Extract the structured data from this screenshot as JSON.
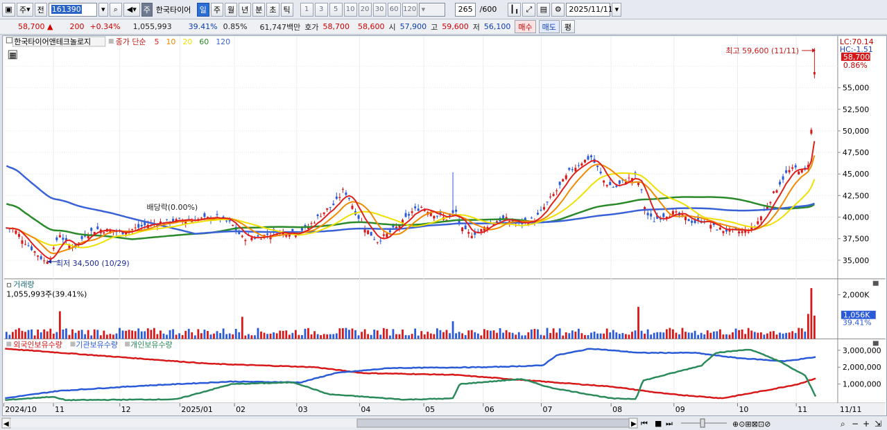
{
  "toolbar": {
    "market": "주",
    "prev_btn": "전",
    "stock_code": "161390",
    "stock_name": "한국타이어",
    "periods": [
      "일",
      "주",
      "월",
      "년",
      "분",
      "초",
      "틱"
    ],
    "active_period": "일",
    "intervals": [
      "1",
      "3",
      "5",
      "10",
      "20",
      "30",
      "60",
      "120"
    ],
    "count_value": "265",
    "count_total": "/600",
    "date": "2025/11/11"
  },
  "quote": {
    "price": "58,700",
    "change": "200",
    "change_pct": "+0.34%",
    "volume": "1,055,993",
    "vol_ratio": "39.41%",
    "rate": "0.85%",
    "amount": "61,747백만",
    "ask_label": "호가",
    "ask1": "58,700",
    "ask2": "58,600",
    "open_label": "시",
    "open": "57,900",
    "high_label": "고",
    "high": "59,600",
    "low_label": "저",
    "low": "56,100",
    "buy_btn": "매수",
    "sell_btn": "매도",
    "avg_btn": "평"
  },
  "legend": {
    "stock": "한국타이어앤테크놀로지",
    "ma_title": "종가 단순",
    "ma": [
      {
        "p": "5",
        "color": "#e0201c"
      },
      {
        "p": "10",
        "color": "#f08a00"
      },
      {
        "p": "20",
        "color": "#f0e000"
      },
      {
        "p": "60",
        "color": "#2a8a2a"
      },
      {
        "p": "120",
        "color": "#3a62d8"
      }
    ]
  },
  "annotations": {
    "high": "최고 59,600 (11/11)",
    "low": "최저 34,500 (10/29)",
    "dividend": "배당락(0.00%)"
  },
  "price_axis": {
    "lc": "LC:70.14",
    "hc": "HC:-1.51",
    "current": "58,700",
    "current_pct": "0.86%",
    "ticks": [
      "55,000",
      "52,500",
      "50,000",
      "47,500",
      "45,000",
      "42,500",
      "40,000",
      "37,500",
      "35,000"
    ]
  },
  "volume_panel": {
    "title": "거래량",
    "value": "1,055,993주(39.41%)",
    "axis_top": "2,000K",
    "current": "1,056K",
    "current_pct": "39.41%"
  },
  "holdings_panel": {
    "series": [
      {
        "name": "외국인보유수량",
        "color": "#d81818"
      },
      {
        "name": "기관보유수량",
        "color": "#2a5ad8"
      },
      {
        "name": "개인보유수량",
        "color": "#2a8a5a"
      }
    ],
    "ticks": [
      "3,000,000",
      "2,000,000",
      "1,000,000"
    ]
  },
  "x_axis": {
    "labels": [
      "2024/10",
      "11",
      "12",
      "2025/01",
      "02",
      "03",
      "04",
      "05",
      "06",
      "07",
      "08",
      "09",
      "10",
      "11",
      "11/11"
    ]
  }
}
